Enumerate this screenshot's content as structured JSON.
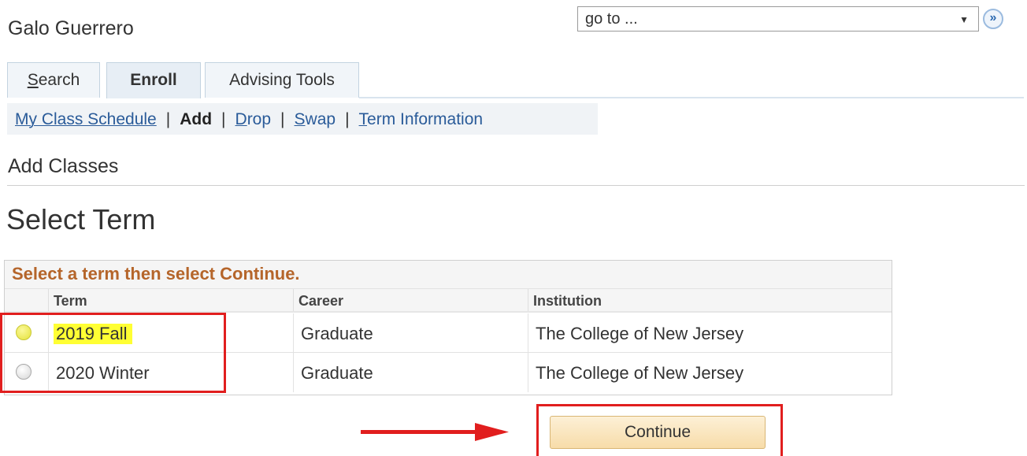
{
  "header": {
    "student_name": "Galo Guerrero"
  },
  "goto": {
    "value": "go to ...",
    "caret": "▼",
    "go_glyph": "»"
  },
  "tabs": [
    {
      "label": "Search",
      "underline": "S",
      "rest": "earch"
    },
    {
      "label": "Enroll"
    },
    {
      "label": "Advising Tools"
    }
  ],
  "subnav": {
    "items": [
      {
        "label": "My Class Schedule"
      },
      {
        "label": "Add",
        "current": true
      },
      {
        "label": "Drop",
        "underline": "D",
        "rest": "rop"
      },
      {
        "label": "Swap",
        "underline": "S",
        "rest": "wap"
      },
      {
        "label": "Term Information",
        "underline": "T",
        "rest": "erm Information"
      }
    ],
    "separator": "|"
  },
  "section_title": "Add Classes",
  "page_title": "Select Term",
  "grid": {
    "caption": "Select a term then select Continue.",
    "columns": [
      "Term",
      "Career",
      "Institution"
    ],
    "rows": [
      {
        "term": "2019 Fall",
        "career": "Graduate",
        "institution": "The College of New Jersey",
        "highlighted": true
      },
      {
        "term": "2020 Winter",
        "career": "Graduate",
        "institution": "The College of New Jersey",
        "highlighted": false
      }
    ]
  },
  "actions": {
    "continue_label": "Continue"
  },
  "colors": {
    "caption_text": "#b5652a",
    "link": "#2a5b99",
    "annotation_red": "#e11e1e",
    "highlight_yellow": "#ffff33",
    "button_bg": "#f7dca9"
  }
}
